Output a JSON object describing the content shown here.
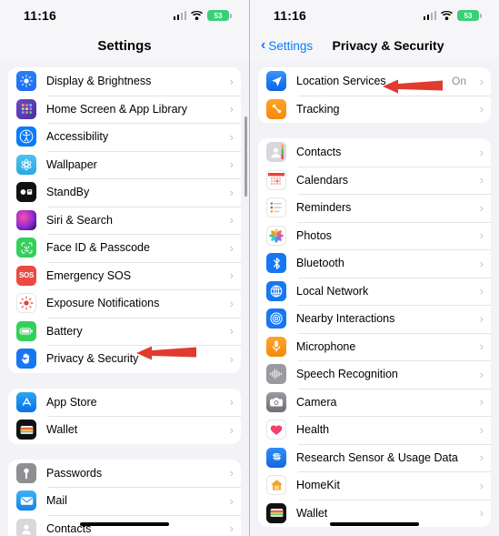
{
  "left_screen": {
    "status_bar": {
      "time": "11:16",
      "battery_level": "53",
      "wifi_icon": "wifi-icon",
      "cellular_icon": "cellular-signal-icon"
    },
    "nav": {
      "title": "Settings"
    },
    "groups": [
      {
        "rows": [
          {
            "label": "Display & Brightness",
            "icon": "display-brightness-icon",
            "value": "",
            "chevron": "›"
          },
          {
            "label": "Home Screen & App Library",
            "icon": "home-screen-icon",
            "value": "",
            "chevron": "›"
          },
          {
            "label": "Accessibility",
            "icon": "accessibility-icon",
            "value": "",
            "chevron": "›"
          },
          {
            "label": "Wallpaper",
            "icon": "wallpaper-icon",
            "value": "",
            "chevron": "›"
          },
          {
            "label": "StandBy",
            "icon": "standby-icon",
            "value": "",
            "chevron": "›"
          },
          {
            "label": "Siri & Search",
            "icon": "siri-icon",
            "value": "",
            "chevron": "›"
          },
          {
            "label": "Face ID & Passcode",
            "icon": "face-id-icon",
            "value": "",
            "chevron": "›"
          },
          {
            "label": "Emergency SOS",
            "icon": "emergency-sos-icon",
            "value": "",
            "chevron": "›"
          },
          {
            "label": "Exposure Notifications",
            "icon": "exposure-notifications-icon",
            "value": "",
            "chevron": "›"
          },
          {
            "label": "Battery",
            "icon": "battery-icon",
            "value": "",
            "chevron": "›"
          },
          {
            "label": "Privacy & Security",
            "icon": "privacy-security-icon",
            "value": "",
            "chevron": "›"
          }
        ]
      },
      {
        "rows": [
          {
            "label": "App Store",
            "icon": "app-store-icon",
            "value": "",
            "chevron": "›"
          },
          {
            "label": "Wallet",
            "icon": "wallet-icon",
            "value": "",
            "chevron": "›"
          }
        ]
      },
      {
        "rows": [
          {
            "label": "Passwords",
            "icon": "passwords-icon",
            "value": "",
            "chevron": "›"
          },
          {
            "label": "Mail",
            "icon": "mail-icon",
            "value": "",
            "chevron": "›"
          },
          {
            "label": "Contacts",
            "icon": "contacts-icon",
            "value": "",
            "chevron": "›"
          }
        ]
      }
    ]
  },
  "right_screen": {
    "status_bar": {
      "time": "11:16",
      "battery_level": "53",
      "wifi_icon": "wifi-icon",
      "cellular_icon": "cellular-signal-icon"
    },
    "nav": {
      "back_label": "Settings",
      "back_chevron": "‹",
      "title": "Privacy & Security"
    },
    "groups": [
      {
        "rows": [
          {
            "label": "Location Services",
            "icon": "location-services-icon",
            "value": "On",
            "chevron": "›"
          },
          {
            "label": "Tracking",
            "icon": "tracking-icon",
            "value": "",
            "chevron": "›"
          }
        ]
      },
      {
        "rows": [
          {
            "label": "Contacts",
            "icon": "contacts-icon",
            "value": "",
            "chevron": "›"
          },
          {
            "label": "Calendars",
            "icon": "calendars-icon",
            "value": "",
            "chevron": "›"
          },
          {
            "label": "Reminders",
            "icon": "reminders-icon",
            "value": "",
            "chevron": "›"
          },
          {
            "label": "Photos",
            "icon": "photos-icon",
            "value": "",
            "chevron": "›"
          },
          {
            "label": "Bluetooth",
            "icon": "bluetooth-icon",
            "value": "",
            "chevron": "›"
          },
          {
            "label": "Local Network",
            "icon": "local-network-icon",
            "value": "",
            "chevron": "›"
          },
          {
            "label": "Nearby Interactions",
            "icon": "nearby-interactions-icon",
            "value": "",
            "chevron": "›"
          },
          {
            "label": "Microphone",
            "icon": "microphone-icon",
            "value": "",
            "chevron": "›"
          },
          {
            "label": "Speech Recognition",
            "icon": "speech-recognition-icon",
            "value": "",
            "chevron": "›"
          },
          {
            "label": "Camera",
            "icon": "camera-icon",
            "value": "",
            "chevron": "›"
          },
          {
            "label": "Health",
            "icon": "health-icon",
            "value": "",
            "chevron": "›"
          },
          {
            "label": "Research Sensor & Usage Data",
            "icon": "research-sensor-icon",
            "value": "",
            "chevron": "›"
          },
          {
            "label": "HomeKit",
            "icon": "homekit-icon",
            "value": "",
            "chevron": "›"
          },
          {
            "label": "Wallet",
            "icon": "wallet-icon",
            "value": "",
            "chevron": "›"
          }
        ]
      }
    ]
  },
  "annotations": {
    "color": "#e03b2f",
    "left_arrow_target": "Privacy & Security",
    "right_arrow_target": "Location Services"
  }
}
